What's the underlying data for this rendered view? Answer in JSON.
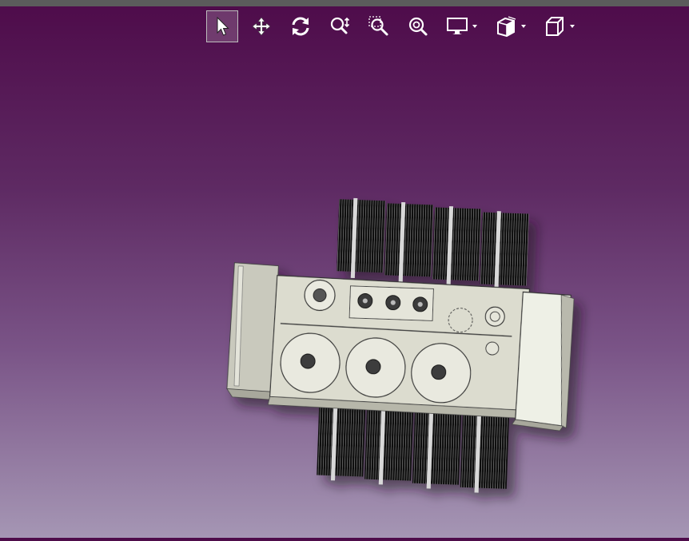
{
  "toolbar": {
    "tools": [
      {
        "id": "select",
        "icon": "pointer-arrow-icon",
        "active": true
      },
      {
        "id": "pan",
        "icon": "move-arrows-icon",
        "active": false
      },
      {
        "id": "rotate",
        "icon": "rotate-icon",
        "active": false
      },
      {
        "id": "zoom-dynamic",
        "icon": "zoom-dynamic-icon",
        "active": false
      },
      {
        "id": "zoom-window",
        "icon": "zoom-window-icon",
        "active": false
      },
      {
        "id": "zoom-fit",
        "icon": "zoom-fit-icon",
        "active": false
      },
      {
        "id": "display-mode",
        "icon": "monitor-icon",
        "has_dropdown": true
      },
      {
        "id": "section",
        "icon": "section-cube-icon",
        "has_dropdown": true
      },
      {
        "id": "view-orientation",
        "icon": "wire-cube-icon",
        "has_dropdown": true
      }
    ]
  },
  "viewport": {
    "model": "machine-assembly",
    "background_top": "#4e0b4a",
    "background_bottom": "#a596b4",
    "body_color": "#dcdccf",
    "fin_color": "#0b0b0b"
  }
}
